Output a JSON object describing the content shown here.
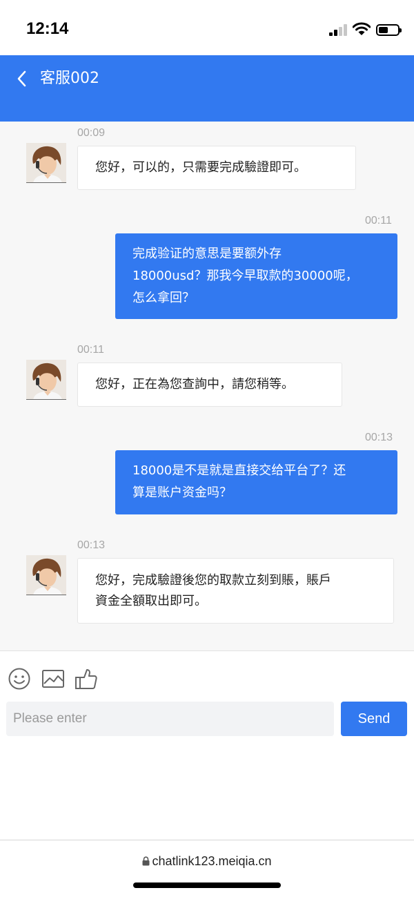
{
  "status_bar": {
    "time": "12:14"
  },
  "header": {
    "title": "客服002"
  },
  "messages": [
    {
      "from": "agent",
      "time": "00:09",
      "lines": [
        "您好，可以的，只需要完成驗證即可。"
      ]
    },
    {
      "from": "user",
      "time": "00:11",
      "lines": [
        "完成验证的意思是要额外存",
        "18000usd？那我今早取款的30000呢，",
        "怎么拿回？"
      ]
    },
    {
      "from": "agent",
      "time": "00:11",
      "lines": [
        "您好，正在為您查詢中，請您稍等。"
      ]
    },
    {
      "from": "user",
      "time": "00:13",
      "lines": [
        "18000是不是就是直接交给平台了？还",
        "算是账户资金吗？"
      ]
    },
    {
      "from": "agent",
      "time": "00:13",
      "lines": [
        "您好，完成驗證後您的取款立刻到賬，賬戶",
        "資金全額取出即可。"
      ]
    }
  ],
  "toolbar": {
    "icons": [
      "emoji-icon",
      "image-icon",
      "thumbs-up-icon"
    ]
  },
  "composer": {
    "placeholder": "Please enter",
    "send_label": "Send"
  },
  "browser": {
    "url": "chatlink123.meiqia.cn"
  },
  "colors": {
    "accent": "#3279f0",
    "chat_bg": "#f7f7f7"
  }
}
